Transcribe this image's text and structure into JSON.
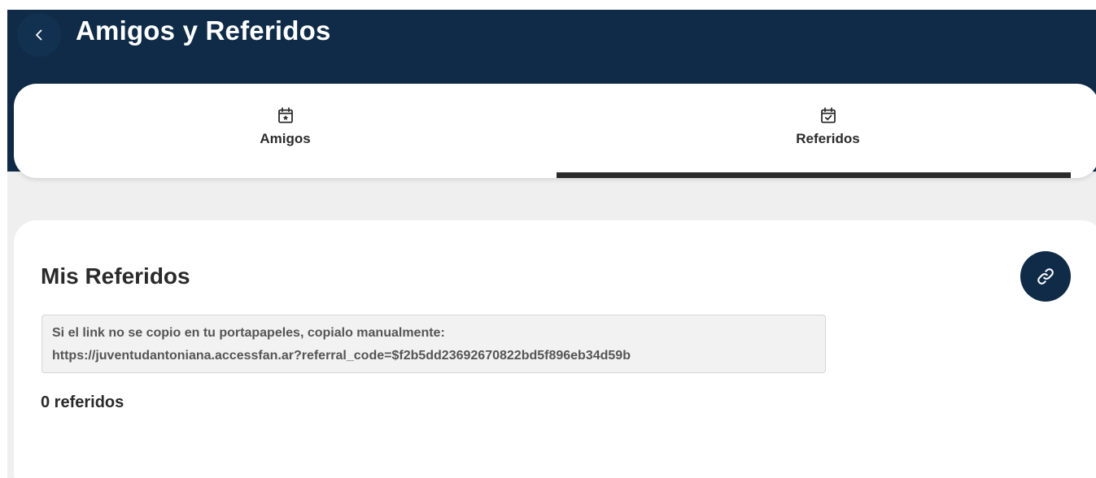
{
  "header": {
    "title": "Amigos y Referidos",
    "back_icon": "chevron-left-icon",
    "background_color": "#0f2b48"
  },
  "tabs": [
    {
      "label": "Amigos",
      "icon": "calendar-star-icon",
      "active": false
    },
    {
      "label": "Referidos",
      "icon": "calendar-check-icon",
      "active": true
    }
  ],
  "main": {
    "section_title": "Mis Referidos",
    "link_icon": "link-icon",
    "notice": {
      "line1": "Si el link no se copio en tu portapapeles, copialo manualmente:",
      "line2": "https://juventudantoniana.accessfan.ar?referral_code=$f2b5dd23692670822bd5f896eb34d59b"
    },
    "count_text": "0 referidos"
  }
}
